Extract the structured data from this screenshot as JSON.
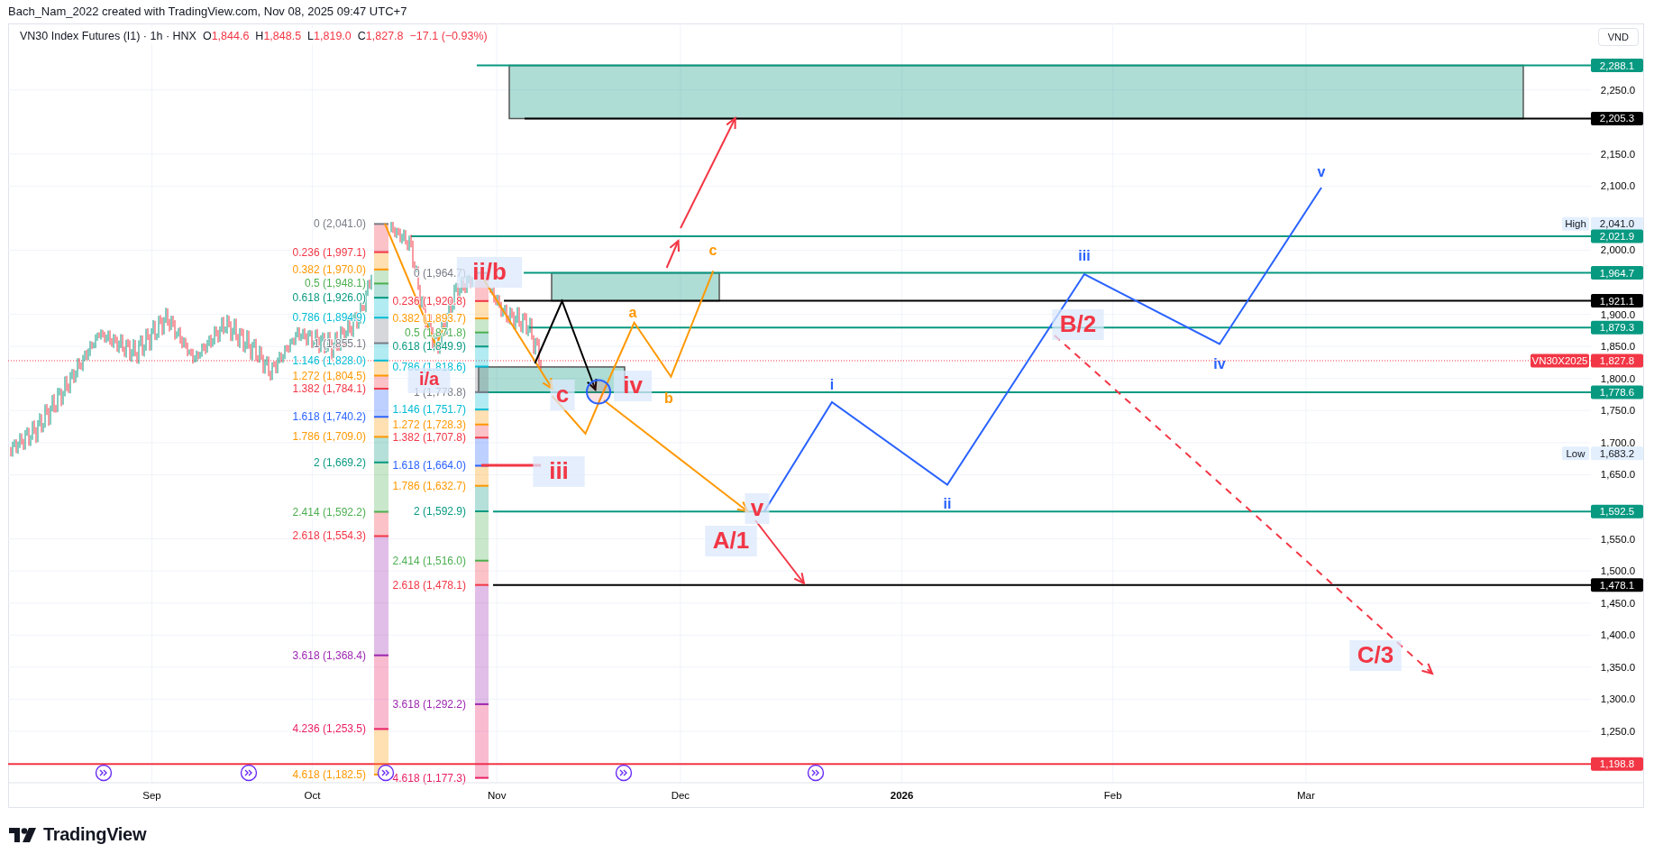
{
  "header": {
    "credit": "Bach_Nam_2022 created with TradingView.com, Nov 08, 2025 09:47 UTC+7"
  },
  "legend": {
    "symbol": "VN30 Index Futures (I1) · 1h · HNX",
    "ohlc": [
      {
        "label": "O",
        "value": "1,844.6"
      },
      {
        "label": "H",
        "value": "1,848.5"
      },
      {
        "label": "L",
        "value": "1,819.0"
      },
      {
        "label": "C",
        "value": "1,827.8"
      }
    ],
    "change": "−17.1 (−0.93%)"
  },
  "price_axis": {
    "unit": "VND",
    "ticks": [
      "2,250.0",
      "2,150.0",
      "2,100.0",
      "2,000.0",
      "1,900.0",
      "1,850.0",
      "1,800.0",
      "1,750.0",
      "1,700.0",
      "1,650.0",
      "1,550.0",
      "1,500.0",
      "1,450.0",
      "1,400.0",
      "1,350.0",
      "1,300.0",
      "1,250.0"
    ],
    "markers": [
      {
        "kind": "line",
        "value": "2,288.1",
        "color": "#089981"
      },
      {
        "kind": "line",
        "value": "2,205.3",
        "color": "#000000"
      },
      {
        "kind": "high",
        "caption": "High",
        "value": "2,041.0"
      },
      {
        "kind": "line",
        "value": "2,021.9",
        "color": "#089981"
      },
      {
        "kind": "line",
        "value": "1,964.7",
        "color": "#089981"
      },
      {
        "kind": "line",
        "value": "1,921.1",
        "color": "#000000"
      },
      {
        "kind": "line",
        "value": "1,879.3",
        "color": "#089981"
      },
      {
        "kind": "symbol",
        "caption": "VN30X2025",
        "value": "1,827.8",
        "color": "#f23645"
      },
      {
        "kind": "line",
        "value": "1,778.6",
        "color": "#089981"
      },
      {
        "kind": "low",
        "caption": "Low",
        "value": "1,683.2"
      },
      {
        "kind": "line",
        "value": "1,592.5",
        "color": "#089981"
      },
      {
        "kind": "line",
        "value": "1,478.1",
        "color": "#000000"
      },
      {
        "kind": "line",
        "value": "1,198.8",
        "color": "#f23645"
      }
    ]
  },
  "time_axis": [
    {
      "label": "Sep",
      "bold": false
    },
    {
      "label": "Oct",
      "bold": false
    },
    {
      "label": "Nov",
      "bold": false
    },
    {
      "label": "Dec",
      "bold": false
    },
    {
      "label": "2026",
      "bold": true
    },
    {
      "label": "Feb",
      "bold": false
    },
    {
      "label": "Mar",
      "bold": false
    }
  ],
  "fib_retracements": [
    {
      "levels": [
        {
          "label": "0 (2,041.0)",
          "color": "#787b86"
        },
        {
          "label": "0.236 (1,997.1)",
          "color": "#f23645"
        },
        {
          "label": "0.382 (1,970.0)",
          "color": "#ff9800"
        },
        {
          "label": "0.5 (1,948.1)",
          "color": "#4caf50"
        },
        {
          "label": "0.618 (1,926.0)",
          "color": "#089981"
        },
        {
          "label": "0.786 (1,894.9)",
          "color": "#00bcd4"
        },
        {
          "label": "1 (1,855.1)",
          "color": "#787b86"
        },
        {
          "label": "1.146 (1,828.0)",
          "color": "#00bcd4"
        },
        {
          "label": "1.272 (1,804.5)",
          "color": "#ff9800"
        },
        {
          "label": "1.382 (1,784.1)",
          "color": "#f23645"
        },
        {
          "label": "1.618 (1,740.2)",
          "color": "#2962ff"
        },
        {
          "label": "1.786 (1,709.0)",
          "color": "#ff9800"
        },
        {
          "label": "2 (1,669.2)",
          "color": "#089981"
        },
        {
          "label": "2.414 (1,592.2)",
          "color": "#4caf50"
        },
        {
          "label": "2.618 (1,554.3)",
          "color": "#f23645"
        },
        {
          "label": "3.618 (1,368.4)",
          "color": "#9c27b0"
        },
        {
          "label": "4.236 (1,253.5)",
          "color": "#e91e63"
        },
        {
          "label": "4.618 (1,182.5)",
          "color": "#ff9800"
        }
      ]
    },
    {
      "levels": [
        {
          "label": "0 (1,964.7)",
          "color": "#787b86"
        },
        {
          "label": "0.236 (1,920.8)",
          "color": "#f23645"
        },
        {
          "label": "0.382 (1,893.7)",
          "color": "#ff9800"
        },
        {
          "label": "0.5 (1,871.8)",
          "color": "#4caf50"
        },
        {
          "label": "0.618 (1,849.9)",
          "color": "#089981"
        },
        {
          "label": "0.786 (1,818.6)",
          "color": "#00bcd4"
        },
        {
          "label": "1 (1,778.8)",
          "color": "#787b86"
        },
        {
          "label": "1.146 (1,751.7)",
          "color": "#00bcd4"
        },
        {
          "label": "1.272 (1,728.3)",
          "color": "#ff9800"
        },
        {
          "label": "1.382 (1,707.8)",
          "color": "#f23645"
        },
        {
          "label": "1.618 (1,664.0)",
          "color": "#2962ff"
        },
        {
          "label": "1.786 (1,632.7)",
          "color": "#ff9800"
        },
        {
          "label": "2 (1,592.9)",
          "color": "#089981"
        },
        {
          "label": "2.414 (1,516.0)",
          "color": "#4caf50"
        },
        {
          "label": "2.618 (1,478.1)",
          "color": "#f23645"
        },
        {
          "label": "3.618 (1,292.2)",
          "color": "#9c27b0"
        },
        {
          "label": "4.618 (1,177.3)",
          "color": "#e91e63"
        }
      ]
    }
  ],
  "wave_labels": [
    {
      "text": "i/a",
      "kind": "major",
      "color": "#f23645"
    },
    {
      "text": "ii/b",
      "kind": "major",
      "color": "#f23645"
    },
    {
      "text": "c",
      "kind": "major",
      "color": "#f23645"
    },
    {
      "text": "iv",
      "kind": "major",
      "color": "#f23645"
    },
    {
      "text": "iii",
      "kind": "major",
      "color": "#f23645"
    },
    {
      "text": "v",
      "kind": "major",
      "color": "#f23645"
    },
    {
      "text": "A/1",
      "kind": "major",
      "color": "#f23645"
    },
    {
      "text": "B/2",
      "kind": "major",
      "color": "#f23645"
    },
    {
      "text": "C/3",
      "kind": "major",
      "color": "#f23645"
    },
    {
      "text": "a",
      "kind": "minor",
      "color": "#ff9800"
    },
    {
      "text": "b",
      "kind": "minor",
      "color": "#ff9800"
    },
    {
      "text": "c",
      "kind": "minor",
      "color": "#ff9800"
    },
    {
      "text": "i",
      "kind": "minor",
      "color": "#2962ff"
    },
    {
      "text": "ii",
      "kind": "minor",
      "color": "#2962ff"
    },
    {
      "text": "iii",
      "kind": "minor",
      "color": "#2962ff"
    },
    {
      "text": "iv",
      "kind": "minor",
      "color": "#2962ff"
    },
    {
      "text": "v",
      "kind": "minor",
      "color": "#2962ff"
    }
  ],
  "footer": {
    "brand": "TradingView"
  }
}
